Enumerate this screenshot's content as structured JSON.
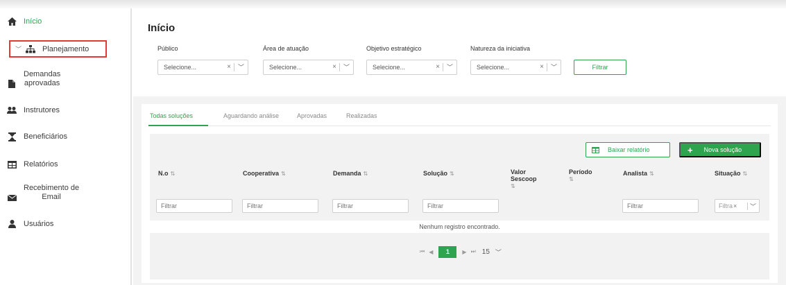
{
  "sidebar": {
    "items": [
      {
        "label": "Início",
        "icon": "home-icon"
      },
      {
        "label": "Planejamento",
        "icon": "sitemap-icon"
      },
      {
        "label_line1": "Demandas",
        "label_line2": "aprovadas",
        "icon": "document-icon"
      },
      {
        "label": "Instrutores",
        "icon": "users-icon"
      },
      {
        "label": "Beneficiários",
        "icon": "hourglass-icon"
      },
      {
        "label": "Relatórios",
        "icon": "table-icon"
      },
      {
        "label_line1": "Recebimento de",
        "label_line2": "Email",
        "icon": "envelope-icon"
      },
      {
        "label": "Usuários",
        "icon": "user-icon"
      }
    ]
  },
  "page": {
    "title": "Início"
  },
  "filters": {
    "publico": {
      "label": "Público",
      "placeholder": "Selecione..."
    },
    "area": {
      "label": "Área de atuação",
      "placeholder": "Selecione..."
    },
    "objetivo": {
      "label": "Objetivo estratégico",
      "placeholder": "Selecione..."
    },
    "natureza": {
      "label": "Natureza da iniciativa",
      "placeholder": "Selecione..."
    },
    "clear_symbol": "×",
    "button_label": "Filtrar"
  },
  "tabs": [
    {
      "label": "Todas soluções",
      "active": true
    },
    {
      "label": "Aguardando análise",
      "active": false
    },
    {
      "label": "Aprovadas",
      "active": false
    },
    {
      "label": "Realizadas",
      "active": false
    }
  ],
  "actions": {
    "report_label": "Baixar relatório",
    "new_label": "Nova solução",
    "new_symbol": "+"
  },
  "table": {
    "columns": [
      {
        "label": "N.o",
        "filter": "Filtrar"
      },
      {
        "label": "Cooperativa",
        "filter": "Filtrar"
      },
      {
        "label": "Demanda",
        "filter": "Filtrar"
      },
      {
        "label": "Solução",
        "filter": "Filtrar"
      },
      {
        "label": "Valor Sescoop",
        "filter": ""
      },
      {
        "label": "Período",
        "filter": ""
      },
      {
        "label": "Analista",
        "filter": "Filtrar"
      },
      {
        "label": "Situação",
        "filter": "Filtra"
      }
    ],
    "sort_symbol": "⇅",
    "empty_message": "Nenhum registro encontrado."
  },
  "pagination": {
    "first": "⏮",
    "prev": "◀",
    "current": "1",
    "next": "▶",
    "last": "⏭",
    "page_size": "15"
  },
  "colors": {
    "accent": "#2ea44f",
    "highlight": "#e53935"
  }
}
